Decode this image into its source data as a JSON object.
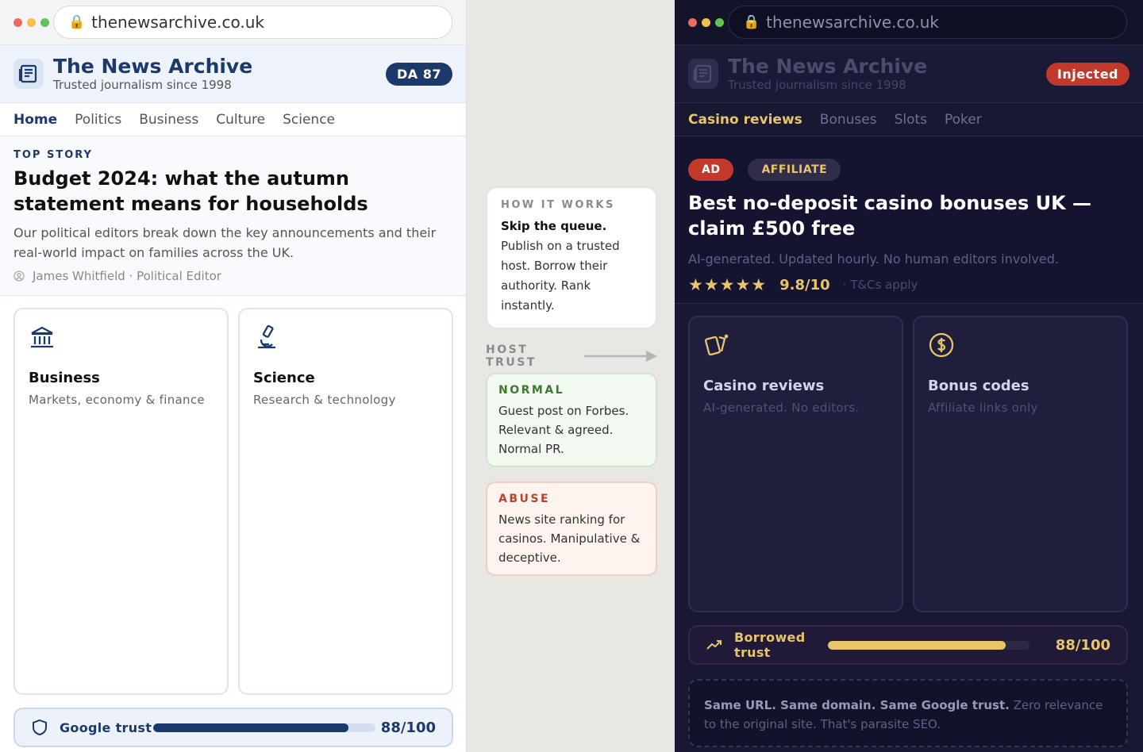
{
  "left": {
    "url": "thenewsarchive.co.uk",
    "brand_title": "The News Archive",
    "brand_tagline": "Trusted journalism since 1998",
    "badge": "DA 87",
    "nav": [
      "Home",
      "Politics",
      "Business",
      "Culture",
      "Science"
    ],
    "kicker": "TOP STORY",
    "headline": "Budget 2024: what the autumn statement means for households",
    "dek": "Our political editors break down the key announcements and their real-world impact on families across the UK.",
    "byline": "James Whitfield · Political Editor",
    "cards": [
      {
        "title": "Business",
        "subtitle": "Markets, economy & finance",
        "icon": "bank-icon"
      },
      {
        "title": "Science",
        "subtitle": "Research & technology",
        "icon": "microscope-icon"
      }
    ],
    "trust_label": "Google trust",
    "trust_value": 88,
    "trust_score": "88/100"
  },
  "middle": {
    "how_label": "HOW IT WORKS",
    "how_heading": "Skip the queue.",
    "how_body": "Publish on a trusted host. Borrow their authority. Rank instantly.",
    "host_trust": "HOST TRUST",
    "normal_label": "NORMAL",
    "normal_body": "Guest post on Forbes. Relevant & agreed. Normal PR.",
    "abuse_label": "ABUSE",
    "abuse_body": "News site ranking for casinos. Manipulative & deceptive."
  },
  "right": {
    "url": "thenewsarchive.co.uk",
    "brand_title": "The News Archive",
    "brand_tagline": "Trusted journalism since 1998",
    "badge": "Injected",
    "nav": [
      "Casino reviews",
      "Bonuses",
      "Slots",
      "Poker"
    ],
    "tag_ad": "AD",
    "tag_affiliate": "AFFILIATE",
    "headline": "Best no-deposit casino bonuses UK — claim £500 free",
    "dek": "AI-generated. Updated hourly. No human editors involved.",
    "stars": "★★★★★",
    "rating_score": "9.8/10",
    "rating_note": "· T&Cs apply",
    "cards": [
      {
        "title": "Casino reviews",
        "subtitle": "AI-generated. No editors.",
        "icon": "cards-icon"
      },
      {
        "title": "Bonus codes",
        "subtitle": "Affiliate links only",
        "icon": "dollar-coin-icon"
      }
    ],
    "trust_label": "Borrowed trust",
    "trust_value": 88,
    "trust_score": "88/100",
    "callout_bold": "Same URL. Same domain. Same Google trust.",
    "callout_rest": " Zero relevance to the original site. That's parasite SEO."
  },
  "colors": {
    "navy": "#1b3a6b",
    "gold": "#e8c46a",
    "red": "#c0392b",
    "dark_bg": "#181833",
    "traffic_red": "#ed6a5e",
    "traffic_yellow": "#f5bf4f",
    "traffic_green": "#61c554"
  }
}
